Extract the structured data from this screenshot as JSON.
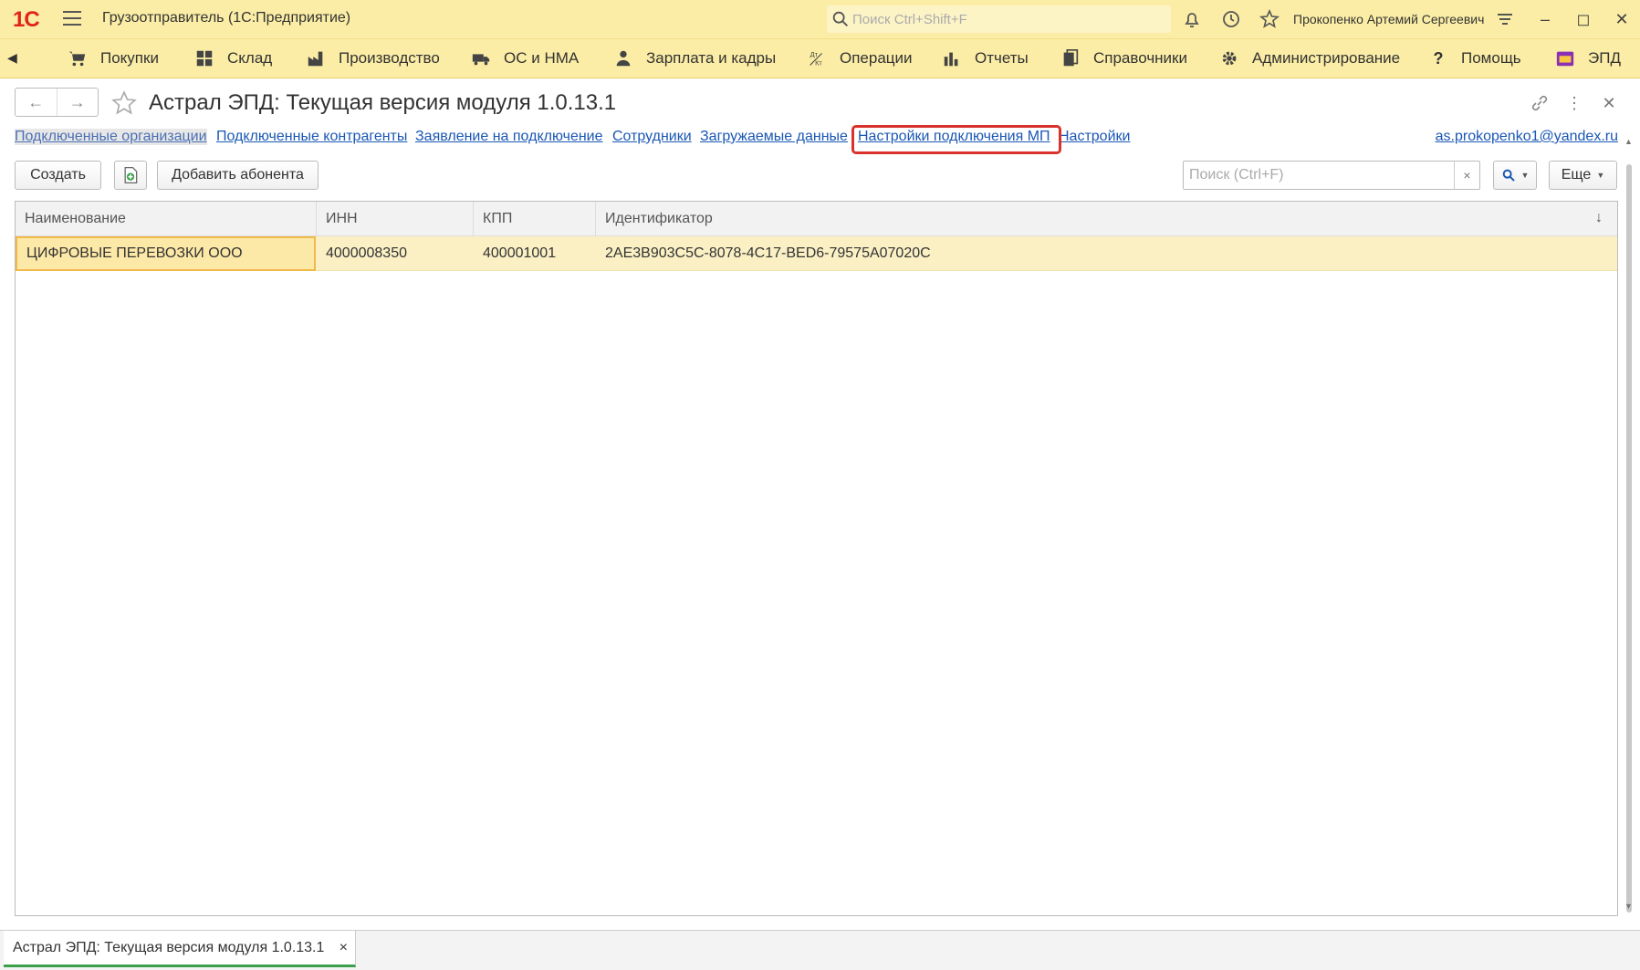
{
  "titlebar": {
    "logo": "1С",
    "app_title": "Грузоотправитель  (1С:Предприятие)",
    "search_placeholder": "Поиск Ctrl+Shift+F",
    "user_name": "Прокопенко Артемий Сергеевич"
  },
  "sections": [
    {
      "label": "Покупки",
      "icon": "cart-icon"
    },
    {
      "label": "Склад",
      "icon": "warehouse-icon"
    },
    {
      "label": "Производство",
      "icon": "factory-icon"
    },
    {
      "label": "ОС и НМА",
      "icon": "truck-icon"
    },
    {
      "label": "Зарплата и кадры",
      "icon": "person-icon"
    },
    {
      "label": "Операции",
      "icon": "operations-icon"
    },
    {
      "label": "Отчеты",
      "icon": "chart-icon"
    },
    {
      "label": "Справочники",
      "icon": "books-icon"
    },
    {
      "label": "Администрирование",
      "icon": "gear-icon"
    },
    {
      "label": "Помощь",
      "icon": "help-icon"
    },
    {
      "label": "ЭПД",
      "icon": "folder-icon"
    }
  ],
  "form": {
    "title": "Астрал ЭПД: Текущая версия модуля 1.0.13.1"
  },
  "navlinks": [
    {
      "label": "Подключенные организации",
      "active": true
    },
    {
      "label": "Подключенные контрагенты"
    },
    {
      "label": "Заявление на подключение"
    },
    {
      "label": "Сотрудники"
    },
    {
      "label": "Загружаемые данные"
    },
    {
      "label": "Настройки подключения МП",
      "highlighted": true
    },
    {
      "label": "Настройки"
    }
  ],
  "email": "as.prokopenko1@yandex.ru",
  "commandbar": {
    "create_label": "Создать",
    "add_subscriber_label": "Добавить абонента",
    "search_placeholder": "Поиск (Ctrl+F)",
    "clear_label": "×",
    "more_label": "Еще"
  },
  "table": {
    "columns": [
      "Наименование",
      "ИНН",
      "КПП",
      "Идентификатор"
    ],
    "rows": [
      [
        "ЦИФРОВЫЕ ПЕРЕВОЗКИ ООО",
        "4000008350",
        "400001001",
        "2AE3B903C5C-8078-4C17-BED6-79575A07020C"
      ]
    ],
    "sort_indicator": "↓"
  },
  "bottom_tab": {
    "label": "Астрал ЭПД: Текущая версия модуля 1.0.13.1",
    "close": "×"
  },
  "colors": {
    "bar_bg": "#fbeda5",
    "link": "#1a57b4",
    "highlight": "#d9322d",
    "row_selected": "#fbf0c4"
  }
}
